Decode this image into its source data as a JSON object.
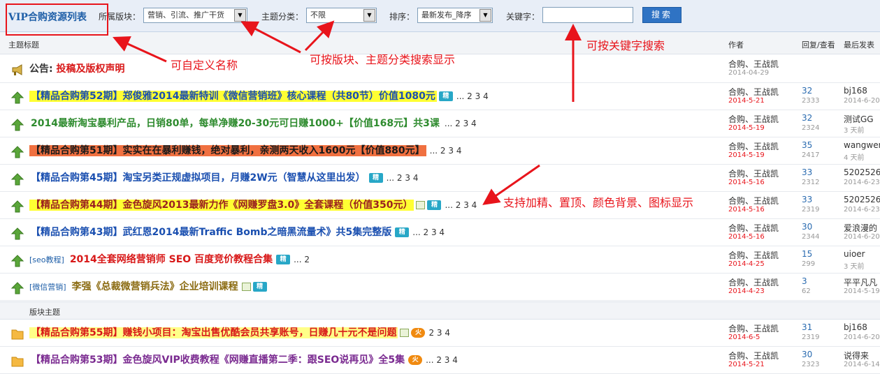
{
  "filter": {
    "title": "VIP合购资源列表",
    "board_label": "所属版块：",
    "board_value": "营销、引流、推广干货",
    "type_label": "主题分类：",
    "type_value": "不限",
    "sort_label": "排序：",
    "sort_value": "最新发布_降序",
    "keyword_label": "关键字：",
    "keyword_value": "",
    "search_label": "搜索"
  },
  "columns": {
    "topic": "主题标题",
    "author": "作者",
    "reply_view": "回复/查看",
    "last": "最后发表"
  },
  "notice": {
    "label": "公告:",
    "title": "投稿及版权声明",
    "author": "合购、王战凯",
    "date": "2014-04-29"
  },
  "threads": [
    {
      "prefix": "",
      "title": "【精品合购第52期】郑俊雅2014最新特训《微信营销班》核心课程（共80节）价值1080元",
      "color": "#1a4fb0",
      "bg": "#ffff33",
      "badge": "精",
      "pages": "... 2 3 4",
      "author": "合购、王战凯",
      "date": "2014-5-21",
      "date_color": "#e8141b",
      "replies": "32",
      "views": "2333",
      "last": "bj168",
      "last_time": "2014-6-20"
    },
    {
      "prefix": "",
      "title": "2014最新淘宝暴利产品，日销80单，每单净赚20-30元可日赚1000+【价值168元】共3课",
      "color": "#2e8b2e",
      "bg": "",
      "badge": "",
      "pages": "... 2 3 4",
      "author": "合购、王战凯",
      "date": "2014-5-19",
      "date_color": "#e8141b",
      "replies": "32",
      "views": "2324",
      "last": "测试GG",
      "last_time": "3 天前"
    },
    {
      "prefix": "",
      "title": "【精品合购第51期】实实在在暴利赚钱，绝对暴利，亲测两天收入1600元【价值880元】",
      "color": "#1a1a1a",
      "bg": "#f07040",
      "badge": "",
      "pages": "... 2 3 4",
      "author": "合购、王战凯",
      "date": "2014-5-19",
      "date_color": "#e8141b",
      "replies": "35",
      "views": "2417",
      "last": "wangwen",
      "last_time": "4 天前"
    },
    {
      "prefix": "",
      "title": "【精品合购第45期】淘宝另类正规虚拟项目，月赚2W元（智慧从这里出发）",
      "color": "#1a4fb0",
      "bg": "",
      "badge": "精",
      "pages": "... 2 3 4",
      "author": "合购、王战凯",
      "date": "2014-5-16",
      "date_color": "#e8141b",
      "replies": "33",
      "views": "2312",
      "last": "5202526",
      "last_time": "2014-6-23"
    },
    {
      "prefix": "",
      "title": "【精品合购第44期】金色旋风2013最新力作《网赚罗盘3.0》全套课程（价值350元）",
      "color": "#9a2020",
      "bg": "#ffff33",
      "badge": "精",
      "img": true,
      "pages": "... 2 3 4",
      "author": "合购、王战凯",
      "date": "2014-5-16",
      "date_color": "#e8141b",
      "replies": "33",
      "views": "2319",
      "last": "5202526",
      "last_time": "2014-6-23"
    },
    {
      "prefix": "",
      "title": "【精品合购第43期】武红恩2014最新Traffic Bomb之暗黑流量术》共5集完整版",
      "color": "#1a4fb0",
      "bg": "",
      "badge": "精",
      "pages": "... 2 3 4",
      "author": "合购、王战凯",
      "date": "2014-5-16",
      "date_color": "#e8141b",
      "replies": "30",
      "views": "2344",
      "last": "爱浪漫的",
      "last_time": "2014-6-20"
    },
    {
      "prefix": "[seo教程]",
      "title": "2014全套网络营销师 SEO 百度竞价教程合集",
      "color": "#d81818",
      "bg": "",
      "badge": "精",
      "pages": "... 2",
      "author": "合购、王战凯",
      "date": "2014-4-25",
      "date_color": "#e8141b",
      "replies": "15",
      "views": "299",
      "last": "uioer",
      "last_time": "3 天前"
    },
    {
      "prefix": "[微信营销]",
      "title": "李强《总裁微营销兵法》企业培训课程",
      "color": "#8a6a10",
      "bg": "",
      "badge": "精",
      "img": true,
      "pages": "",
      "author": "合购、王战凯",
      "date": "2014-4-23",
      "date_color": "#e8141b",
      "replies": "3",
      "views": "62",
      "last": "平平凡凡",
      "last_time": "2014-5-19"
    }
  ],
  "section_label": "版块主题",
  "board_threads": [
    {
      "prefix": "",
      "title": "【精品合购第55期】赚钱小项目：淘宝出售优酷会员共享账号，日赚几十元不是问题",
      "color": "#d81818",
      "bg": "#ffff88",
      "badge": "火",
      "img": true,
      "pages": "2 3 4",
      "author": "合购、王战凯",
      "date": "2014-6-5",
      "date_color": "#e8141b",
      "replies": "31",
      "views": "2319",
      "last": "bj168",
      "last_time": "2014-6-20"
    },
    {
      "prefix": "",
      "title": "【精品合购第53期】金色旋风VIP收费教程《网赚直播第二季：跟SEO说再见》全5集",
      "color": "#7a2a90",
      "bg": "",
      "badge": "火",
      "pages": "... 2 3 4",
      "author": "合购、王战凯",
      "date": "2014-5-21",
      "date_color": "#e8141b",
      "replies": "30",
      "views": "2323",
      "last": "说得来",
      "last_time": "2014-6-14"
    }
  ],
  "annotations": {
    "custom_name": "可自定义名称",
    "board_search": "可按版块、主题分类搜索显示",
    "keyword_search": "可按关键字搜索",
    "highlight": "支持加精、置顶、颜色背景、图标显示"
  },
  "colors": {
    "accent": "#1f5fa8",
    "annotation": "#e8141b",
    "search_button": "#2f73c4"
  }
}
